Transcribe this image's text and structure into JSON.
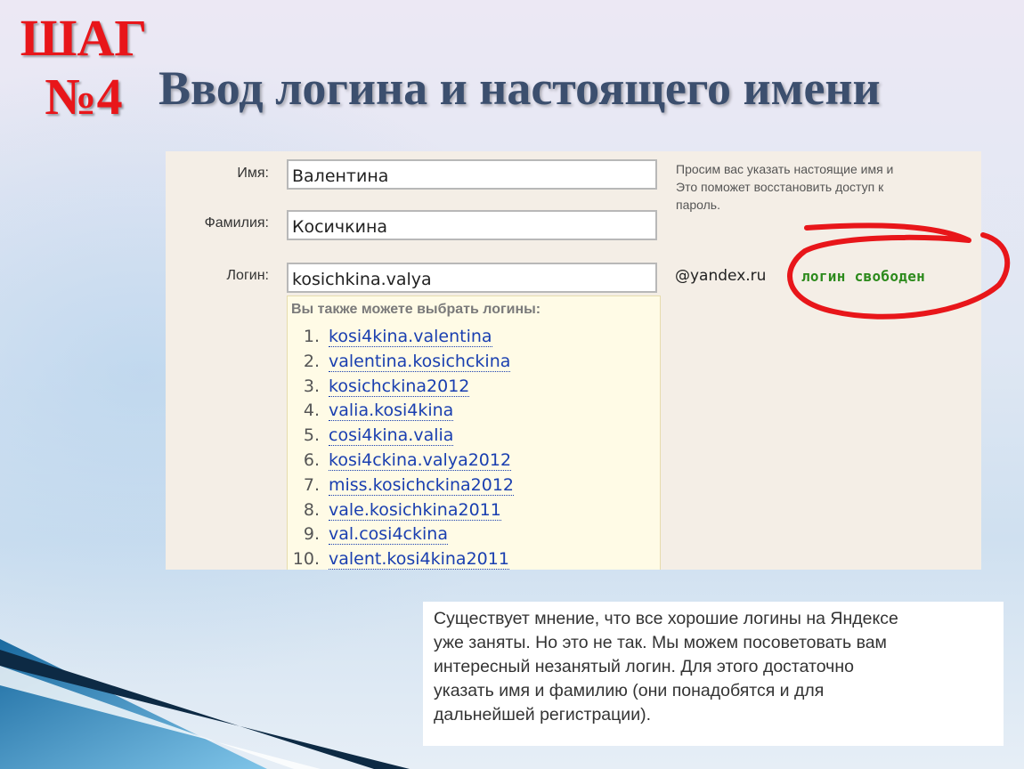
{
  "slide": {
    "step_line1": "ШАГ",
    "step_line2": "№4",
    "title": "Ввод логина и настоящего имени"
  },
  "form": {
    "first_name_label": "Имя:",
    "first_name_value": "Валентина",
    "last_name_label": "Фамилия:",
    "last_name_value": "Косичкина",
    "login_label": "Логин:",
    "login_value": "kosichkina.valya",
    "domain": "@yandex.ru",
    "login_status": "логин свободен",
    "hint_lines": [
      "Просим вас указать настоящие имя и",
      "Это поможет восстановить доступ к",
      "пароль."
    ],
    "suggest_title": "Вы также можете выбрать логины:",
    "suggestions": [
      {
        "num": "1.",
        "login": "kosi4kina.valentina"
      },
      {
        "num": "2.",
        "login": "valentina.kosichckina"
      },
      {
        "num": "3.",
        "login": "kosichckina2012"
      },
      {
        "num": "4.",
        "login": "valia.kosi4kina"
      },
      {
        "num": "5.",
        "login": "cosi4kina.valia"
      },
      {
        "num": "6.",
        "login": "kosi4ckina.valya2012"
      },
      {
        "num": "7.",
        "login": "miss.kosichckina2012"
      },
      {
        "num": "8.",
        "login": "vale.kosichkina2011"
      },
      {
        "num": "9.",
        "login": "val.cosi4ckina"
      },
      {
        "num": "10.",
        "login": "valent.kosi4kina2011"
      }
    ]
  },
  "note_lines": [
    "Существует мнение, что все хорошие логины на Яндексе",
    "уже заняты. Но это не так. Мы можем посоветовать вам",
    "интересный незанятый логин. Для этого достаточно",
    "указать имя и фамилию (они понадобятся и для",
    "дальнейшей регистрации)."
  ],
  "colors": {
    "step": "#e8161a",
    "title": "#3c4f6e",
    "link": "#1a3fb0",
    "status_ok": "#2c8a1c",
    "annotation": "#e8161a"
  }
}
